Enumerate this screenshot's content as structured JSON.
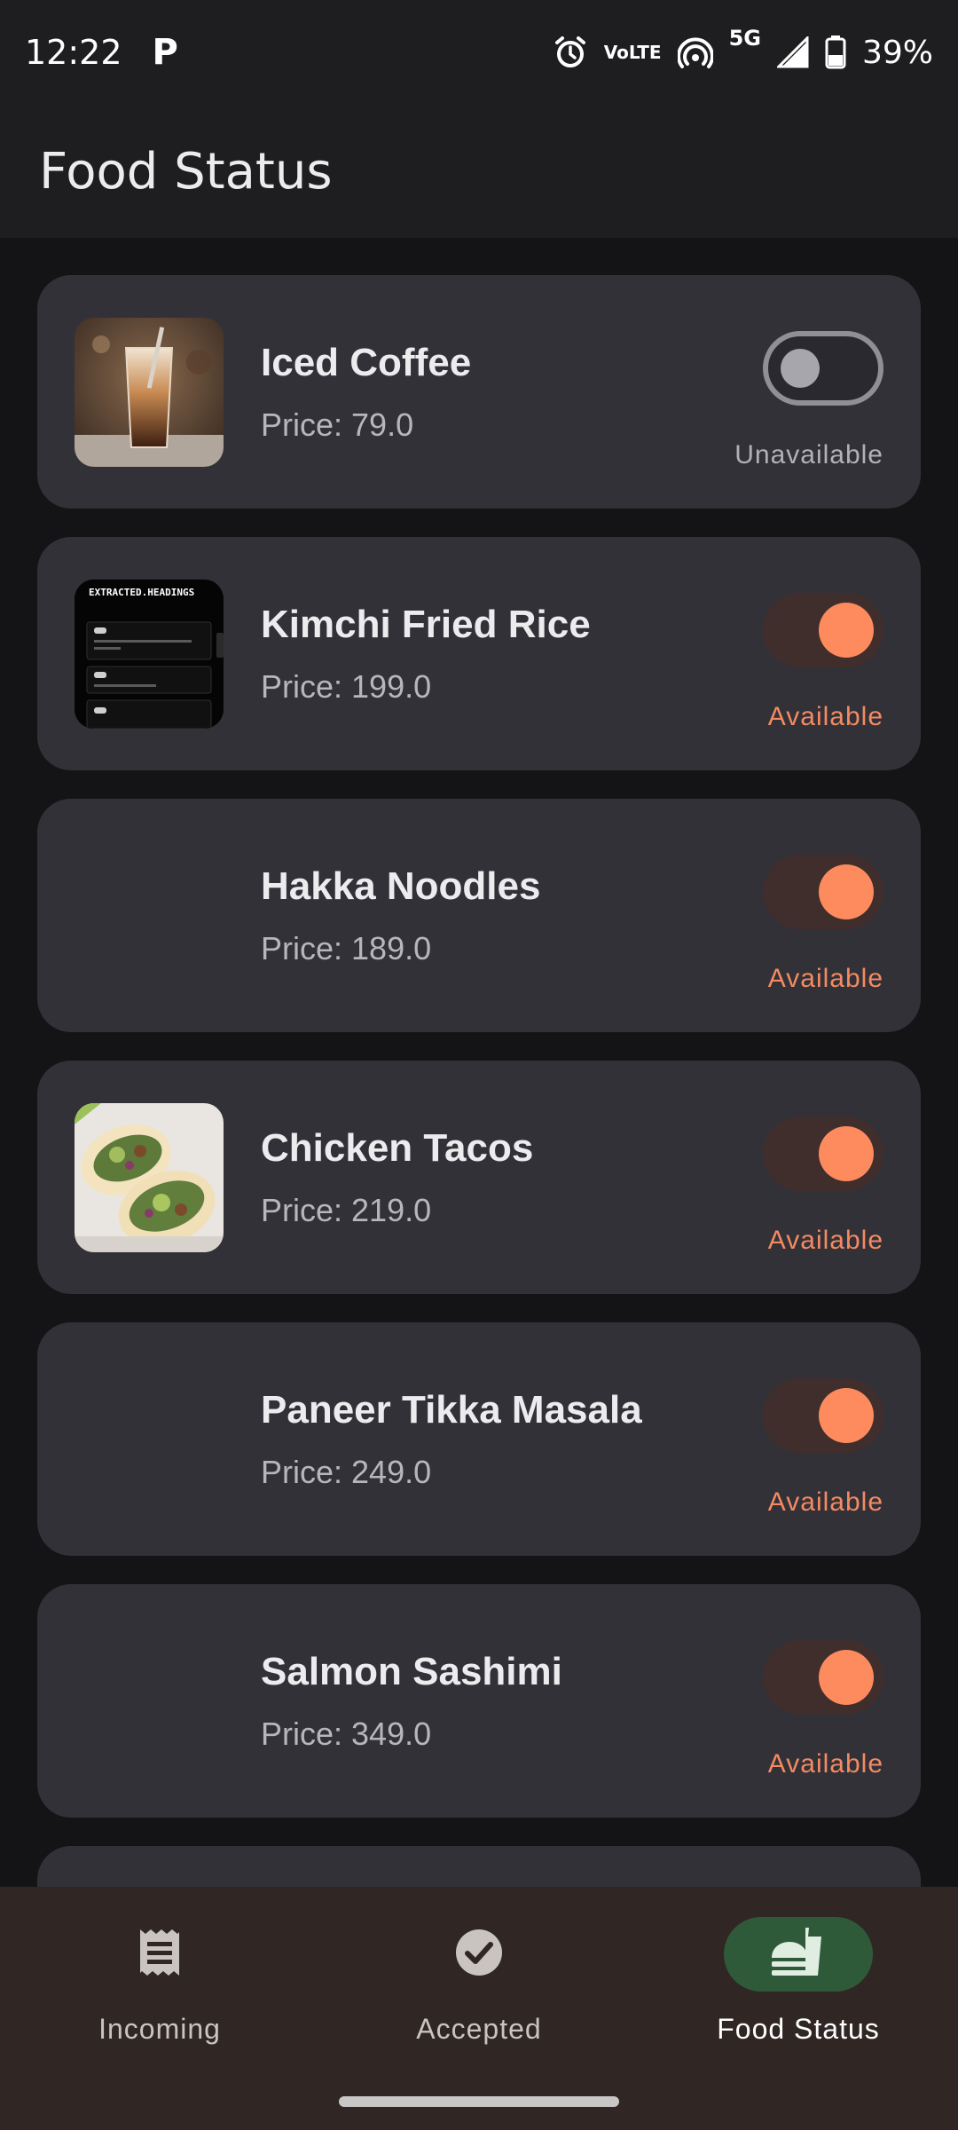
{
  "status_bar": {
    "time": "12:22",
    "notification": "P",
    "volte_top": "Vo",
    "volte_bottom": "LTE",
    "network": "5G",
    "battery": "39%"
  },
  "app_bar": {
    "title": "Food Status"
  },
  "items": [
    {
      "name": "Iced Coffee",
      "price": "Price: 79.0",
      "status": "Unavailable",
      "available": false,
      "thumb": "iced-coffee-photo"
    },
    {
      "name": "Kimchi Fried Rice",
      "price": "Price: 199.0",
      "status": "Available",
      "available": true,
      "thumb": "screenshot-thumbnail"
    },
    {
      "name": "Hakka Noodles",
      "price": "Price: 189.0",
      "status": "Available",
      "available": true,
      "thumb": ""
    },
    {
      "name": "Chicken Tacos",
      "price": "Price: 219.0",
      "status": "Available",
      "available": true,
      "thumb": "tacos-photo"
    },
    {
      "name": "Paneer Tikka Masala",
      "price": "Price: 249.0",
      "status": "Available",
      "available": true,
      "thumb": ""
    },
    {
      "name": "Salmon Sashimi",
      "price": "Price: 349.0",
      "status": "Available",
      "available": true,
      "thumb": ""
    }
  ],
  "thumb_texts": {
    "screenshot_title": "EXTRACTED.HEADINGS"
  },
  "bottom_nav": {
    "items": [
      {
        "label": "Incoming",
        "icon": "receipt-icon",
        "active": false
      },
      {
        "label": "Accepted",
        "icon": "check-circle-icon",
        "active": false
      },
      {
        "label": "Food Status",
        "icon": "fastfood-icon",
        "active": true
      }
    ]
  },
  "colors": {
    "accent": "#fe8b5e",
    "card": "#323138",
    "nav_bg": "#302624",
    "nav_active": "#2f5a3a"
  }
}
